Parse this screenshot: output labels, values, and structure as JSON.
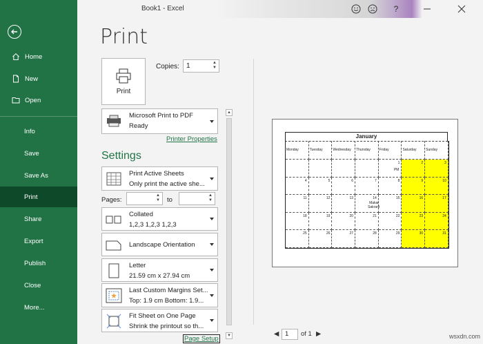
{
  "window": {
    "title": "Book1  -  Excel"
  },
  "titlebar_icons": [
    "smile-icon",
    "frown-icon",
    "help-icon",
    "minimize-icon",
    "close-icon"
  ],
  "nav": {
    "items": [
      {
        "label": "Home",
        "icon": "home-icon"
      },
      {
        "label": "New",
        "icon": "new-document-icon"
      },
      {
        "label": "Open",
        "icon": "folder-icon"
      },
      {
        "label": "Info"
      },
      {
        "label": "Save"
      },
      {
        "label": "Save As"
      },
      {
        "label": "Print"
      },
      {
        "label": "Share"
      },
      {
        "label": "Export"
      },
      {
        "label": "Publish"
      },
      {
        "label": "Close"
      },
      {
        "label": "More..."
      }
    ],
    "active": "Print"
  },
  "print": {
    "heading": "Print",
    "print_button": "Print",
    "copies_label": "Copies:",
    "copies_value": "1"
  },
  "printer": {
    "name": "Microsoft Print to PDF",
    "status": "Ready",
    "properties_link": "Printer Properties"
  },
  "settings": {
    "heading": "Settings",
    "what": {
      "l1": "Print Active Sheets",
      "l2": "Only print the active she..."
    },
    "pages_label": "Pages:",
    "to_label": "to",
    "collate": {
      "l1": "Collated",
      "l2": "1,2,3    1,2,3    1,2,3"
    },
    "orientation": {
      "l1": "Landscape Orientation"
    },
    "paper": {
      "l1": "Letter",
      "l2": "21.59 cm x 27.94 cm"
    },
    "margins": {
      "l1": "Last Custom Margins Set...",
      "l2": "Top: 1.9 cm Bottom: 1.9..."
    },
    "scaling": {
      "l1": "Fit Sheet on One Page",
      "l2": "Shrink the printout so th..."
    },
    "page_setup_link": "Page Setup"
  },
  "preview": {
    "calendar_title": "January",
    "days": [
      "Monday",
      "Tuesday",
      "Wednesday",
      "Thursday",
      "Friday",
      "Saturday",
      "Sunday"
    ],
    "rows": [
      [
        "",
        "",
        "",
        "",
        "1",
        "2",
        "3"
      ],
      [
        "4",
        "5",
        "6",
        "7",
        "8",
        "9",
        "10"
      ],
      [
        "11",
        "12",
        "13",
        "14",
        "15",
        "16",
        "17"
      ],
      [
        "18",
        "19",
        "20",
        "21",
        "22",
        "23",
        "24"
      ],
      [
        "25",
        "26",
        "27",
        "28",
        "29",
        "30",
        "31"
      ]
    ],
    "events": [
      {
        "row": 0,
        "col": 4,
        "text": "PM"
      },
      {
        "row": 2,
        "col": 3,
        "text": "Makar"
      },
      {
        "row": 2,
        "col": 3,
        "text2": "Sakrant"
      }
    ],
    "highlight_color": "#ffff00"
  },
  "pager": {
    "current": "1",
    "of_text": "of 1"
  },
  "watermark": "wsxdn.com",
  "colors": {
    "accent": "#217346",
    "nav_active": "#0e4a29"
  }
}
